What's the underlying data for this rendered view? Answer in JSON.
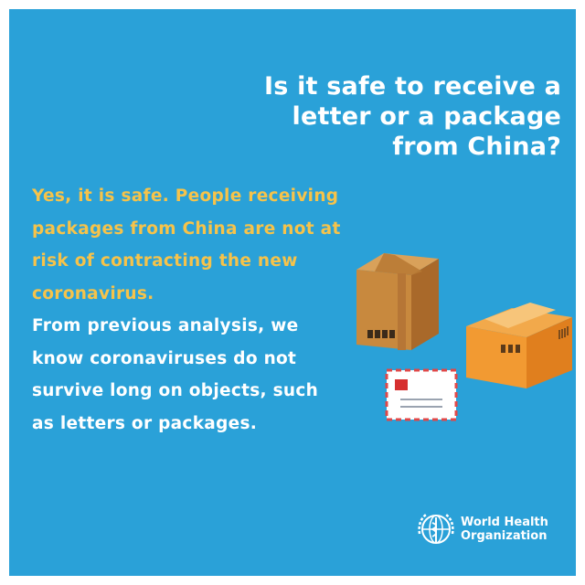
{
  "question": "Is it safe to receive a letter or a package from China?",
  "answer": {
    "highlight": "Yes, it is safe. People receiving packages from China are not at risk of contracting the new coronavirus.",
    "body": "From previous analysis, we know coronaviruses do not survive long on objects, such as letters or packages."
  },
  "organization": {
    "line1": "World Health",
    "line2": "Organization"
  },
  "colors": {
    "background": "#2aa1d8",
    "highlight": "#f6c34a",
    "text": "#ffffff"
  },
  "icons": [
    "tall-box-icon",
    "open-box-icon",
    "envelope-icon",
    "who-emblem-icon"
  ]
}
